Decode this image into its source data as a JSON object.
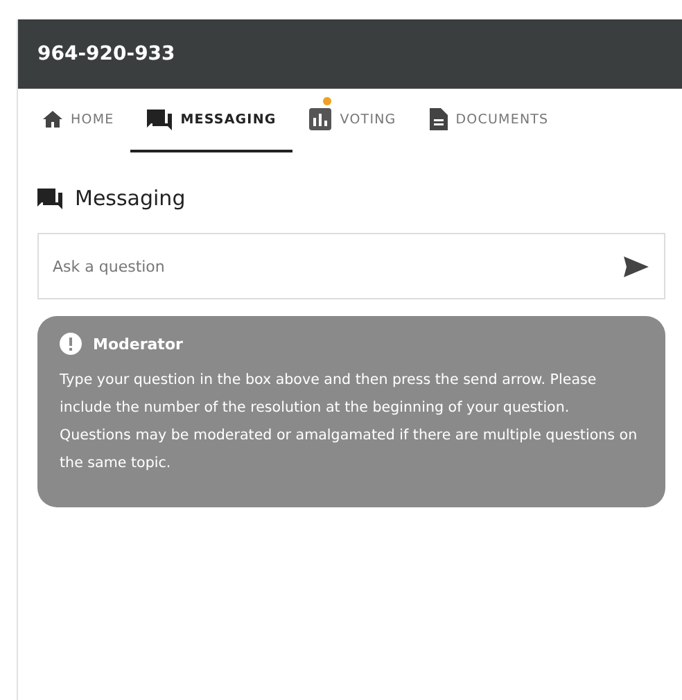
{
  "header": {
    "title": "964-920-933"
  },
  "tabs": [
    {
      "label": "HOME",
      "kind": "home",
      "selected": false,
      "badge": false
    },
    {
      "label": "MESSAGING",
      "kind": "chat",
      "selected": true,
      "badge": false
    },
    {
      "label": "VOTING",
      "kind": "chart",
      "selected": false,
      "badge": true
    },
    {
      "label": "DOCUMENTS",
      "kind": "doc",
      "selected": false,
      "badge": false
    }
  ],
  "section": {
    "title": "Messaging"
  },
  "question_field": {
    "placeholder": "Ask a question"
  },
  "notice": {
    "title": "Moderator",
    "text": "Type your question in the box above and then press the send arrow. Please include the number of the resolution at the beginning of your question. Questions may be moderated or amalgamated if there are multiple questions on the same topic."
  }
}
